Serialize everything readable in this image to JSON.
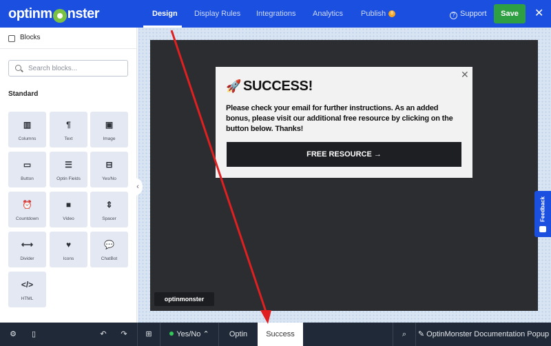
{
  "header": {
    "logo": "optinmonster",
    "tabs": [
      {
        "label": "Design"
      },
      {
        "label": "Display Rules"
      },
      {
        "label": "Integrations"
      },
      {
        "label": "Analytics"
      },
      {
        "label": "Publish",
        "badge": "8"
      }
    ],
    "active_tab": "Design",
    "support_label": "Support",
    "save_label": "Save",
    "accent_color": "#1a4fe0",
    "save_color": "#2ea043"
  },
  "sidebar": {
    "title": "Blocks",
    "search_placeholder": "Search blocks...",
    "section": "Standard",
    "blocks": [
      {
        "label": "Columns",
        "icon": "columns-icon",
        "glyph": "▥"
      },
      {
        "label": "Text",
        "icon": "paragraph-icon",
        "glyph": "¶"
      },
      {
        "label": "Image",
        "icon": "image-icon",
        "glyph": "▣"
      },
      {
        "label": "Button",
        "icon": "cursor-button-icon",
        "glyph": "▭"
      },
      {
        "label": "Optin Fields",
        "icon": "form-fields-icon",
        "glyph": "☰"
      },
      {
        "label": "Yes/No",
        "icon": "yes-no-icon",
        "glyph": "⊟"
      },
      {
        "label": "Countdown",
        "icon": "alarm-clock-icon",
        "glyph": "⏰"
      },
      {
        "label": "Video",
        "icon": "video-camera-icon",
        "glyph": "■"
      },
      {
        "label": "Spacer",
        "icon": "spacer-icon",
        "glyph": "⇕"
      },
      {
        "label": "Divider",
        "icon": "divider-icon",
        "glyph": "⟷"
      },
      {
        "label": "Icons",
        "icon": "heart-icon",
        "glyph": "♥"
      },
      {
        "label": "ChatBot",
        "icon": "chat-bubble-icon",
        "glyph": "💬"
      },
      {
        "label": "HTML",
        "icon": "code-icon",
        "glyph": "</>"
      }
    ]
  },
  "popup": {
    "emoji": "🚀",
    "title": "SUCCESS!",
    "body": "Please check your email for further instructions. As an added bonus, please visit our additional free resource by clicking on the button below. Thanks!",
    "button_label": "FREE RESOURCE →",
    "badge": "optinmonster"
  },
  "feedback_label": "Feedback",
  "bottom_bar": {
    "yes_no_label": "Yes/No",
    "view_optin": "Optin",
    "view_success": "Success",
    "active_view": "Success",
    "campaign_name": "OptinMonster Documentation Popup"
  }
}
